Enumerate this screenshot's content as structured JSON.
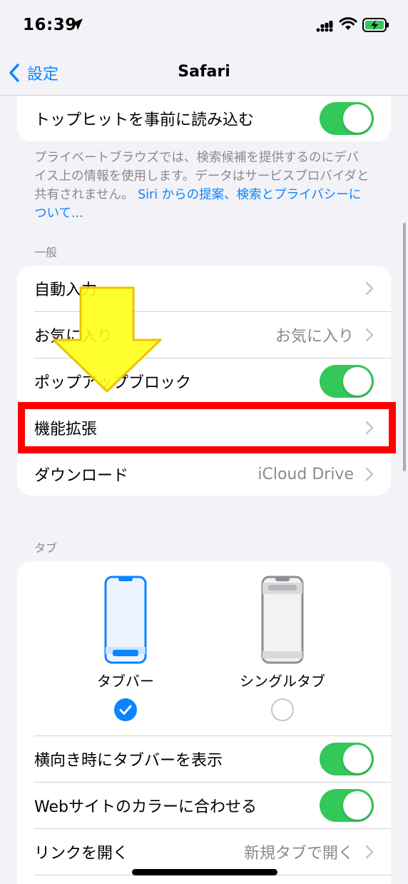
{
  "status_bar": {
    "time": "16:39",
    "icons": [
      "location-arrow-icon",
      "cellular-signal-icon",
      "wifi-icon",
      "battery-charging-icon"
    ]
  },
  "nav": {
    "back_label": "設定",
    "title": "Safari"
  },
  "top_group": {
    "preload_label": "トップヒットを事前に読み込む",
    "preload_on": true
  },
  "privacy_note": {
    "text": "プライベートブラウズでは、検索候補を提供するのにデバイス上の情報を使用します。データはサービスプロバイダと共有されません。",
    "link": "Siri からの提案、検索とプライバシーについて..."
  },
  "general": {
    "header": "一般",
    "autofill_label": "自動入力",
    "favorites_label": "お気に入り",
    "favorites_value": "お気に入り",
    "popup_label": "ポップアップブロック",
    "popup_on": true,
    "extensions_label": "機能拡張",
    "downloads_label": "ダウンロード",
    "downloads_value": "iCloud Drive"
  },
  "tabs": {
    "header": "タブ",
    "tab_bar_label": "タブバー",
    "tab_bar_selected": true,
    "single_tab_label": "シングルタブ",
    "single_tab_selected": false,
    "landscape_label": "横向き時にタブバーを表示",
    "landscape_on": true,
    "website_color_label": "Webサイトのカラーに合わせる",
    "website_color_on": true,
    "open_links_label": "リンクを開く",
    "open_links_value": "新規タブで開く"
  },
  "colors": {
    "accent": "#0a84ff",
    "toggle_on": "#34c759",
    "annotation_box": "#ff0000",
    "annotation_arrow": "#ffff1a"
  }
}
